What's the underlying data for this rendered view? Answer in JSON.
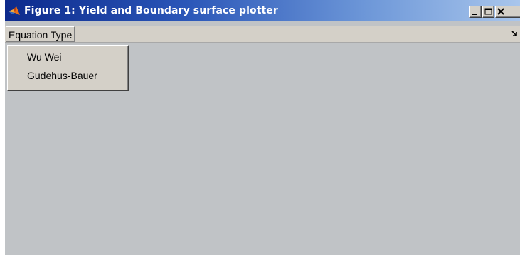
{
  "window": {
    "title": "Figure 1: Yield and Boundary surface plotter",
    "controls": {
      "minimize_icon": "minimize-icon",
      "maximize_icon": "maximize-icon",
      "close_icon": "close-icon"
    }
  },
  "menubar": {
    "menu_label": "Equation Type",
    "overflow_icon": "chevron-arrow-icon"
  },
  "dropdown": {
    "items": [
      {
        "label": "Wu Wei"
      },
      {
        "label": "Gudehus-Bauer"
      }
    ]
  },
  "colors": {
    "titlebar_start": "#0d2a8c",
    "titlebar_end": "#a9c6ec",
    "figure_background": "#c0c3c6",
    "menu_background": "#d4d0c8"
  }
}
